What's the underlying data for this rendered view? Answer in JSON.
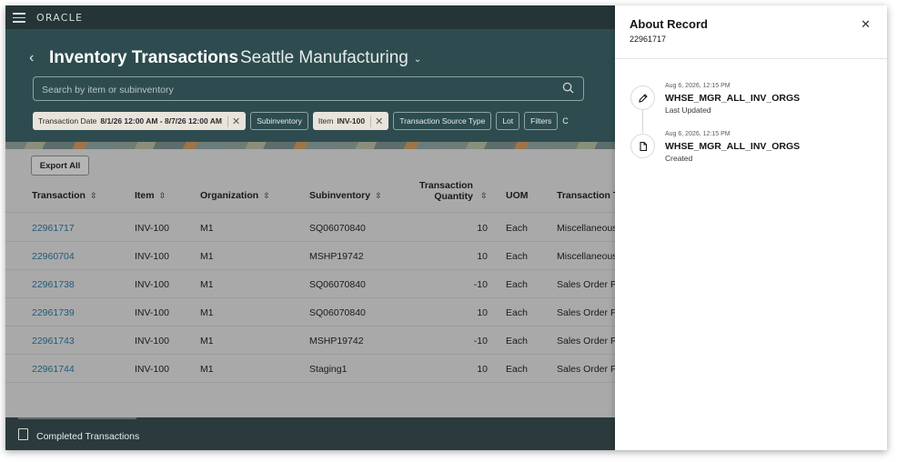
{
  "topbar": {
    "logo": "ORACLE"
  },
  "header": {
    "back": "‹",
    "title": "Inventory Transactions",
    "org": "Seattle Manufacturing",
    "search_placeholder": "Search by item or subinventory",
    "filters": [
      {
        "label": "Transaction Date",
        "value": "8/1/26 12:00 AM - 8/7/26 12:00 AM",
        "selected": true
      },
      {
        "label": "Subinventory",
        "value": "",
        "selected": false
      },
      {
        "label": "Item",
        "value": "INV-100",
        "selected": true
      },
      {
        "label": "Transaction Source Type",
        "value": "",
        "selected": false
      },
      {
        "label": "Lot",
        "value": "",
        "selected": false
      },
      {
        "label": "Filters",
        "value": "",
        "selected": false
      }
    ],
    "filters_overflow": "C"
  },
  "table": {
    "export_label": "Export All",
    "columns": {
      "transaction": "Transaction",
      "item": "Item",
      "organization": "Organization",
      "subinventory": "Subinventory",
      "qty_line1": "Transaction",
      "qty_line2": "Quantity",
      "uom": "UOM",
      "type": "Transaction T"
    },
    "rows": [
      {
        "transaction": "22961717",
        "item": "INV-100",
        "org": "M1",
        "subinventory": "SQ06070840",
        "qty": "10",
        "uom": "Each",
        "type": "Miscellaneous"
      },
      {
        "transaction": "22960704",
        "item": "INV-100",
        "org": "M1",
        "subinventory": "MSHP19742",
        "qty": "10",
        "uom": "Each",
        "type": "Miscellaneous"
      },
      {
        "transaction": "22961738",
        "item": "INV-100",
        "org": "M1",
        "subinventory": "SQ06070840",
        "qty": "-10",
        "uom": "Each",
        "type": "Sales Order P"
      },
      {
        "transaction": "22961739",
        "item": "INV-100",
        "org": "M1",
        "subinventory": "SQ06070840",
        "qty": "10",
        "uom": "Each",
        "type": "Sales Order P"
      },
      {
        "transaction": "22961743",
        "item": "INV-100",
        "org": "M1",
        "subinventory": "MSHP19742",
        "qty": "-10",
        "uom": "Each",
        "type": "Sales Order P"
      },
      {
        "transaction": "22961744",
        "item": "INV-100",
        "org": "M1",
        "subinventory": "Staging1",
        "qty": "10",
        "uom": "Each",
        "type": "Sales Order P"
      }
    ]
  },
  "footer": {
    "label": "Completed Transactions"
  },
  "panel": {
    "title": "About Record",
    "record_id": "22961717",
    "events": [
      {
        "date": "Aug 6, 2026, 12:15 PM",
        "user": "WHSE_MGR_ALL_INV_ORGS",
        "action": "Last Updated",
        "icon": "pencil-icon"
      },
      {
        "date": "Aug 6, 2026, 12:15 PM",
        "user": "WHSE_MGR_ALL_INV_ORGS",
        "action": "Created",
        "icon": "document-icon"
      }
    ]
  },
  "colors": {
    "header_bg": "#2e4c4f",
    "link": "#1f5b7a",
    "overlay": "#a9a9a9"
  }
}
